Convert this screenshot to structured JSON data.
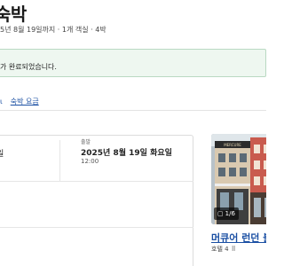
{
  "header": {
    "title": "숙박",
    "subtitle": "5년 8월 19일까지 · 1개 객실 · 4박"
  },
  "banner": {
    "message": "가 완료되었습니다."
  },
  "links": {
    "first": "ι",
    "second": "숙박 요금"
  },
  "stay": {
    "checkin_date": "일",
    "checkout_label": "출발",
    "checkout_date": "2025년 8월 19일 화요일",
    "checkout_time": "12:00"
  },
  "hotel": {
    "image_sign": "MERCURE",
    "photo_count": "1/6",
    "name": "머큐어 런던 블룸",
    "rating_label": "호텔 4",
    "rating_icon": "grid-icon"
  }
}
